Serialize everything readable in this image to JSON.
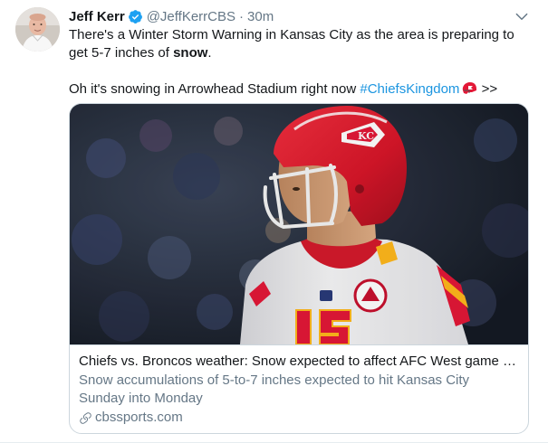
{
  "tweet": {
    "author_name": "Jeff Kerr",
    "author_handle": "@JeffKerrCBS",
    "separator": "·",
    "time": "30m",
    "line1_before": "There's a Winter Storm Warning in Kansas City as the area is preparing to get 5-7 inches of ",
    "line1_bold": "snow",
    "line1_after": ".",
    "line2_text": "Oh it's snowing in Arrowhead Stadium right now ",
    "hashtag": "#ChiefsKingdom",
    "trailing": " >>"
  },
  "card": {
    "title": "Chiefs vs. Broncos weather: Snow expected to affect AFC West game as ...",
    "description": "Snow accumulations of 5-to-7 inches expected to hit Kansas City Sunday into Monday",
    "domain": "cbssports.com",
    "jersey_number": "15"
  },
  "icons": {
    "verified": "verified-badge-icon",
    "more": "chevron-down-icon",
    "link": "link-icon",
    "emoji": "chiefs-helmet-emoji"
  },
  "colors": {
    "link_blue": "#1b95e0",
    "verified_blue": "#1da1f2",
    "secondary_gray": "#657786",
    "chiefs_red": "#e31837"
  }
}
